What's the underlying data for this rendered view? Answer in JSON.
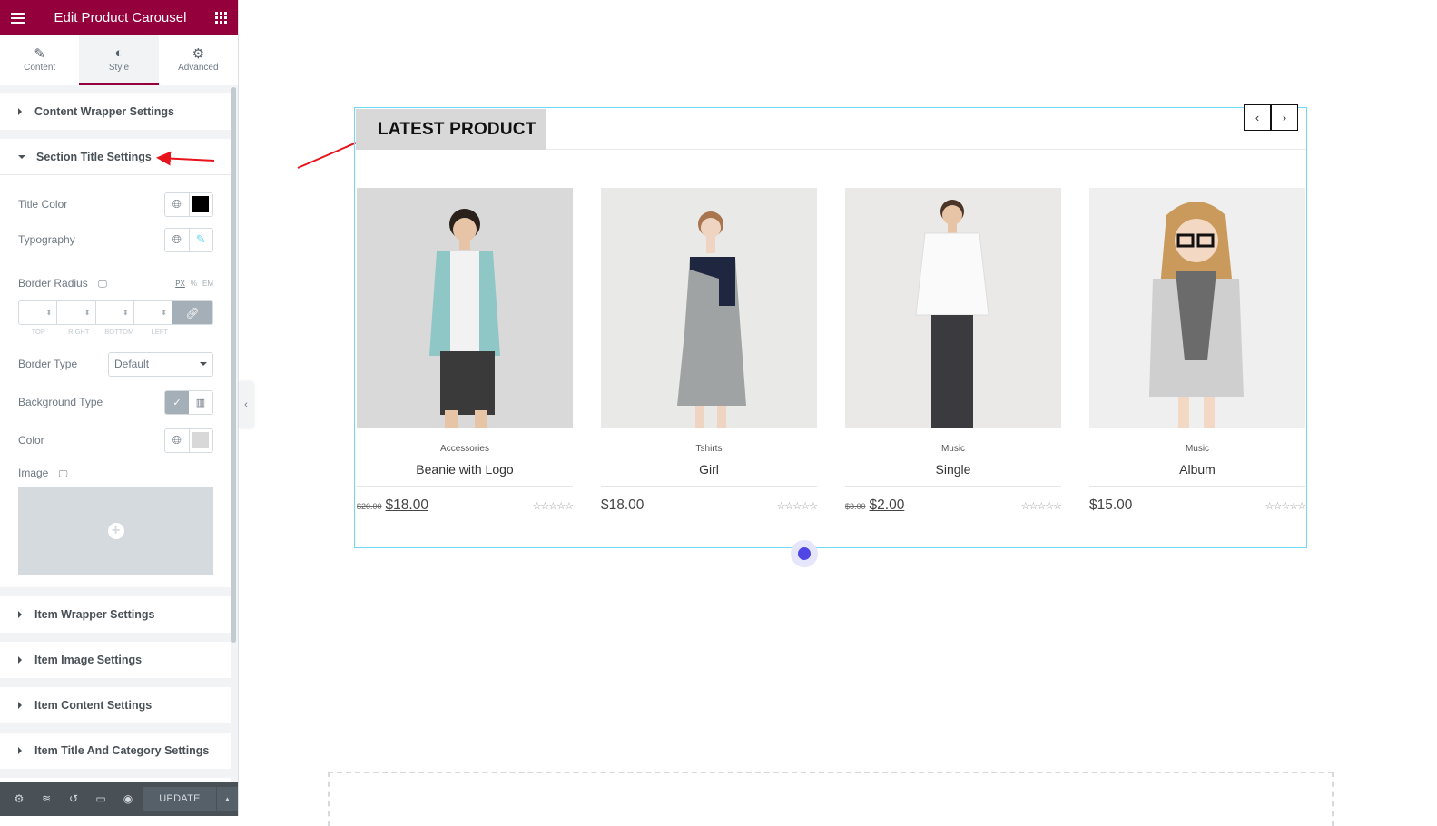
{
  "panel": {
    "title": "Edit Product Carousel",
    "tabs": [
      {
        "label": "Content",
        "icon": "pencil-icon"
      },
      {
        "label": "Style",
        "icon": "contrast-icon"
      },
      {
        "label": "Advanced",
        "icon": "gear-icon"
      }
    ],
    "active_tab": "Style",
    "sections": {
      "content_wrapper": "Content Wrapper Settings",
      "section_title": "Section Title Settings",
      "item_wrapper": "Item Wrapper Settings",
      "item_image": "Item Image Settings",
      "item_content": "Item Content Settings",
      "item_title_category": "Item Title And Category Settings"
    },
    "controls": {
      "title_color": {
        "label": "Title Color",
        "value": "#000000"
      },
      "typography": {
        "label": "Typography"
      },
      "border_radius": {
        "label": "Border Radius",
        "units": [
          "PX",
          "%",
          "EM"
        ],
        "active_unit": "PX",
        "sides": [
          "TOP",
          "RIGHT",
          "BOTTOM",
          "LEFT"
        ]
      },
      "border_type": {
        "label": "Border Type",
        "value": "Default"
      },
      "background_type": {
        "label": "Background Type"
      },
      "color": {
        "label": "Color",
        "value": "#d8d8d8"
      },
      "image": {
        "label": "Image"
      }
    },
    "footer": {
      "update_label": "UPDATE"
    }
  },
  "carousel": {
    "title": "LATEST PRODUCT",
    "products": [
      {
        "category": "Accessories",
        "name": "Beanie with Logo",
        "old_price": "$20.00",
        "price": "$18.00"
      },
      {
        "category": "Tshirts",
        "name": "Girl",
        "old_price": "",
        "price": "$18.00"
      },
      {
        "category": "Music",
        "name": "Single",
        "old_price": "$3.00",
        "price": "$2.00"
      },
      {
        "category": "Music",
        "name": "Album",
        "old_price": "",
        "price": "$15.00"
      }
    ],
    "stars": "☆☆☆☆☆"
  },
  "colors": {
    "brand": "#93003c",
    "annotation_arrow": "#e8141c",
    "widget_border": "#71d7f7",
    "dot": "#5046e5"
  }
}
